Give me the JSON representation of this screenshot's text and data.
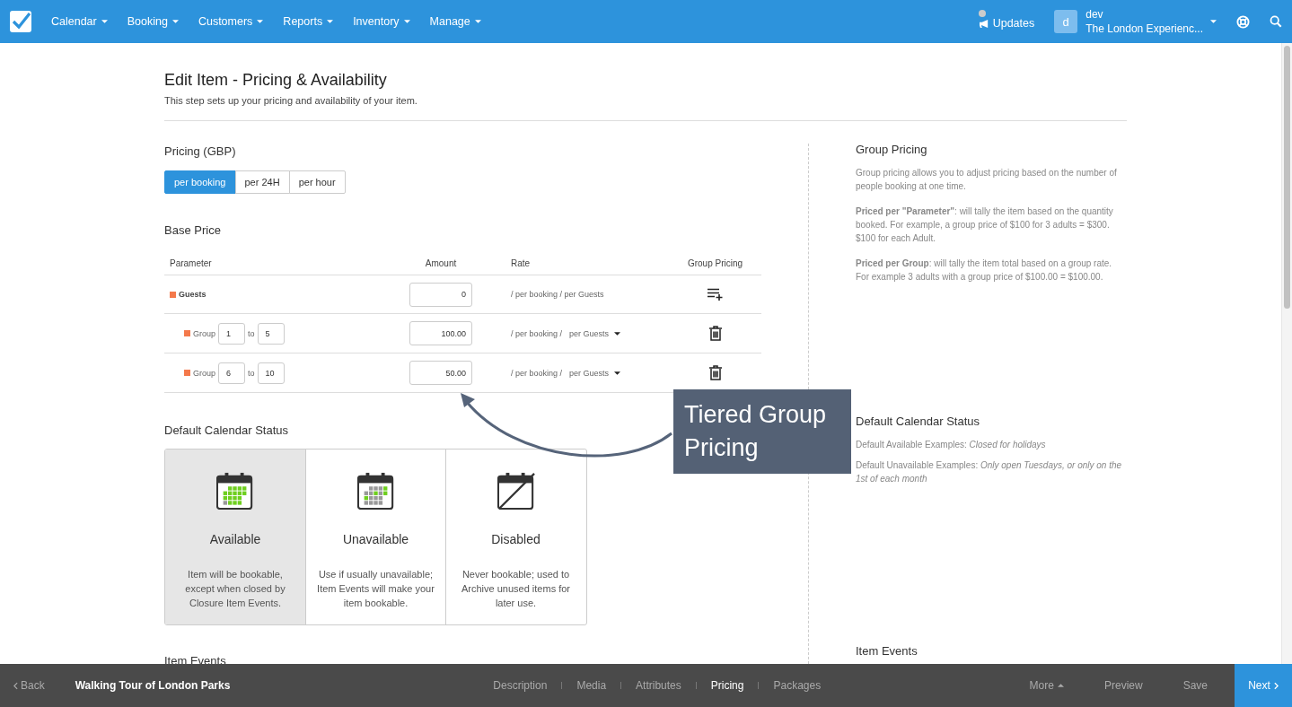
{
  "nav": {
    "menus": [
      {
        "label": "Calendar"
      },
      {
        "label": "Booking"
      },
      {
        "label": "Customers"
      },
      {
        "label": "Reports"
      },
      {
        "label": "Inventory"
      },
      {
        "label": "Manage"
      }
    ],
    "updates": {
      "label": "Updates",
      "unread": true
    },
    "account": {
      "avatar": "d",
      "user": "dev",
      "company": "The London Experienc..."
    }
  },
  "page": {
    "title": "Edit Item - Pricing & Availability",
    "subtitle": "This step sets up your pricing and availability of your item."
  },
  "pricing": {
    "heading": "Pricing (GBP)",
    "units": [
      {
        "label": "per booking",
        "selected": true
      },
      {
        "label": "per 24H",
        "selected": false
      },
      {
        "label": "per hour",
        "selected": false
      }
    ]
  },
  "base_price": {
    "heading": "Base Price",
    "columns": [
      "Parameter",
      "Amount",
      "Rate",
      "Group Pricing"
    ],
    "rows": [
      {
        "kind": "parameter",
        "name": "Guests",
        "amount": "0",
        "rate": "/ per booking / per Guests"
      },
      {
        "kind": "group",
        "name": "Group",
        "from": "1",
        "to_label": "to",
        "to": "5",
        "amount": "100.00",
        "rate": "/ per booking /",
        "rate_unit": "per Guests"
      },
      {
        "kind": "group",
        "name": "Group",
        "from": "6",
        "to_label": "to",
        "to": "10",
        "amount": "50.00",
        "rate": "/ per booking /",
        "rate_unit": "per Guests"
      }
    ]
  },
  "calendar_status": {
    "heading": "Default Calendar Status",
    "options": [
      {
        "kind": "available",
        "label": "Available",
        "description": "Item will be bookable, except when closed by Closure Item Events.",
        "selected": true
      },
      {
        "kind": "unavailable",
        "label": "Unavailable",
        "description": "Use if usually unavailable; Item Events will make your item bookable.",
        "selected": false
      },
      {
        "kind": "disabled",
        "label": "Disabled",
        "description": "Never bookable; used to Archive unused items for later use.",
        "selected": false
      }
    ]
  },
  "item_events": {
    "heading": "Item Events"
  },
  "callout": {
    "text": "Tiered Group Pricing"
  },
  "help": {
    "group_pricing": {
      "heading": "Group Pricing",
      "paragraphs": [
        "Group pricing allows you to adjust pricing based on the number of people booking at one time.",
        "**Priced per \"Parameter\"**: will tally the item based on the quantity booked. For example, a group price of $100 for 3 adults = $300. $100 for each Adult.",
        "**Priced per Group**: will tally the item total based on a group rate. For example 3 adults with a group price of $100.00 = $100.00."
      ]
    },
    "calendar_status": {
      "heading": "Default Calendar Status",
      "lines": [
        "Default Available Examples: *Closed for holidays*",
        "Default Unavailable Examples: *Only open Tuesdays, or only on the 1st of each month*"
      ]
    },
    "item_events": {
      "heading": "Item Events"
    }
  },
  "footer": {
    "back": "Back",
    "item_title": "Walking Tour of London Parks",
    "steps": [
      {
        "label": "Description",
        "selected": false
      },
      {
        "label": "Media",
        "selected": false
      },
      {
        "label": "Attributes",
        "selected": false
      },
      {
        "label": "Pricing",
        "selected": true
      },
      {
        "label": "Packages",
        "selected": false
      }
    ],
    "more": "More",
    "preview": "Preview",
    "save": "Save",
    "next": "Next"
  }
}
